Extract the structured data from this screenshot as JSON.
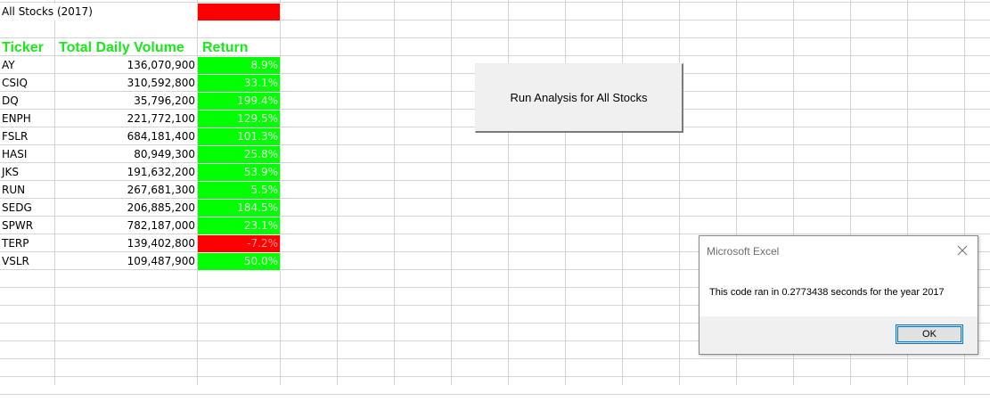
{
  "sheet": {
    "title": "All Stocks (2017)",
    "headers": {
      "ticker": "Ticker",
      "volume": "Total Daily Volume",
      "return": "Return"
    },
    "rows": [
      {
        "ticker": "AY",
        "volume": "136,070,900",
        "return": "8.9%",
        "negative": false
      },
      {
        "ticker": "CSIQ",
        "volume": "310,592,800",
        "return": "33.1%",
        "negative": false
      },
      {
        "ticker": "DQ",
        "volume": "35,796,200",
        "return": "199.4%",
        "negative": false
      },
      {
        "ticker": "ENPH",
        "volume": "221,772,100",
        "return": "129.5%",
        "negative": false
      },
      {
        "ticker": "FSLR",
        "volume": "684,181,400",
        "return": "101.3%",
        "negative": false
      },
      {
        "ticker": "HASI",
        "volume": "80,949,300",
        "return": "25.8%",
        "negative": false
      },
      {
        "ticker": "JKS",
        "volume": "191,632,200",
        "return": "53.9%",
        "negative": false
      },
      {
        "ticker": "RUN",
        "volume": "267,681,300",
        "return": "5.5%",
        "negative": false
      },
      {
        "ticker": "SEDG",
        "volume": "206,885,200",
        "return": "184.5%",
        "negative": false
      },
      {
        "ticker": "SPWR",
        "volume": "782,187,000",
        "return": "23.1%",
        "negative": false
      },
      {
        "ticker": "TERP",
        "volume": "139,402,800",
        "return": "-7.2%",
        "negative": true
      },
      {
        "ticker": "VSLR",
        "volume": "109,487,900",
        "return": "50.0%",
        "negative": false
      }
    ]
  },
  "button": {
    "label": "Run Analysis for All Stocks"
  },
  "dialog": {
    "title": "Microsoft Excel",
    "message": "This code ran in 0.2773438 seconds for the year 2017",
    "ok_label": "OK",
    "close_icon": "close-icon"
  },
  "colors": {
    "header_text": "#1be81b",
    "positive_fill": "#00ff00",
    "negative_fill": "#ff0000",
    "gridline": "#d4d4d4"
  }
}
